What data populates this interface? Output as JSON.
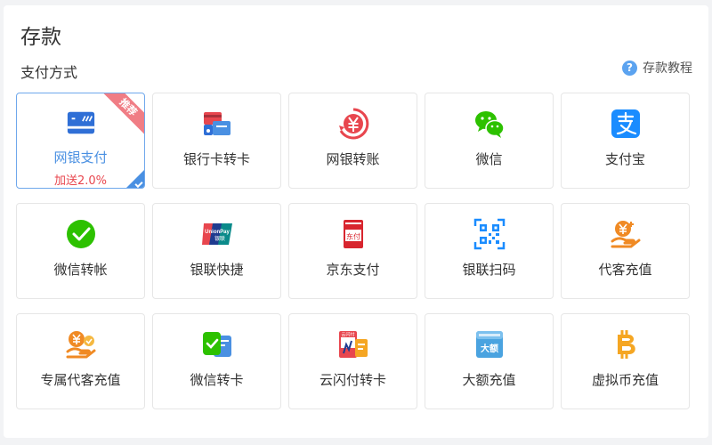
{
  "header": {
    "title": "存款"
  },
  "section": {
    "title": "支付方式"
  },
  "help": {
    "label": "存款教程",
    "icon": "question-icon"
  },
  "methods": [
    {
      "label": "网银支付",
      "bonus": "加送2.0%",
      "badge": "推荐",
      "selected": true,
      "icon": "bank-card-icon"
    },
    {
      "label": "银行卡转卡",
      "icon": "card-transfer-icon"
    },
    {
      "label": "网银转账",
      "icon": "yen-transfer-icon"
    },
    {
      "label": "微信",
      "icon": "wechat-icon"
    },
    {
      "label": "支付宝",
      "icon": "alipay-icon"
    },
    {
      "label": "微信转帐",
      "icon": "wechat-check-icon"
    },
    {
      "label": "银联快捷",
      "icon": "unionpay-icon"
    },
    {
      "label": "京东支付",
      "icon": "jd-pay-icon"
    },
    {
      "label": "银联扫码",
      "icon": "qr-code-icon"
    },
    {
      "label": "代客充值",
      "icon": "agent-recharge-icon"
    },
    {
      "label": "专属代客充值",
      "icon": "exclusive-agent-icon"
    },
    {
      "label": "微信转卡",
      "icon": "wechat-card-icon"
    },
    {
      "label": "云闪付转卡",
      "icon": "quickpass-card-icon"
    },
    {
      "label": "大额充值",
      "icon": "large-amount-icon"
    },
    {
      "label": "虚拟币充值",
      "icon": "bitcoin-icon"
    }
  ],
  "unionpay_text": {
    "line1": "UnionPay",
    "line2": "银联"
  },
  "jd_text": "东付",
  "large_text": "大额",
  "quickpass_text": "云闪付",
  "colors": {
    "accent": "#4a90e2",
    "badge": "#f07d85",
    "bonus": "#e8464e",
    "wechat": "#2dc100",
    "alipay": "#1a8cff",
    "orange": "#f08a24"
  }
}
